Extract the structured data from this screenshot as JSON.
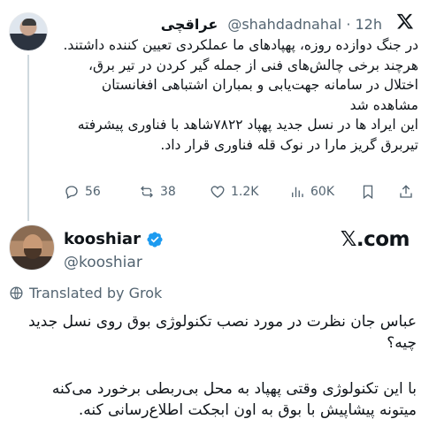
{
  "parent_tweet": {
    "display_name": "عراقچی",
    "handle": "@shahdadnahal",
    "separator": "·",
    "time": "12h",
    "paragraphs": [
      "در جنگ دوازده روزه، پهپادهای ما عملکردی تعیین کننده داشتند.",
      "هرچند برخی چالش‌های فنی از جمله گیر کردن در تیر برق، اختلال در سامانه جهت‌یابی و بمباران اشتباهی افغانستان مشاهده شد",
      "این ایراد ها در نسل جدید پهپاد ۷۸۲۲شاهد با فناوری پیشرفته تیربرق گریز مارا در نوک قله فناوری قرار داد."
    ],
    "actions": {
      "replies": "56",
      "reposts": "38",
      "likes": "1.2K",
      "views": "60K"
    }
  },
  "reply_tweet": {
    "display_name": "kooshiar",
    "handle": "@kooshiar",
    "brand": "𝕏.com",
    "translated_label": "Translated by Grok",
    "paragraphs": [
      "عباس جان نظرت در مورد نصب تکنولوژی بوق روی نسل جدید چیه؟",
      "با این تکنولوژی وقتی پهپاد به محل بی‌ربطی برخورد می‌کنه میتونه پیشاپیش با بوق به اون ابجکت اطلاع‌رسانی کنه."
    ]
  },
  "colors": {
    "text": "#0f1419",
    "muted": "#536471",
    "verified": "#1d9bf0",
    "thread_line": "#cfd9de"
  }
}
